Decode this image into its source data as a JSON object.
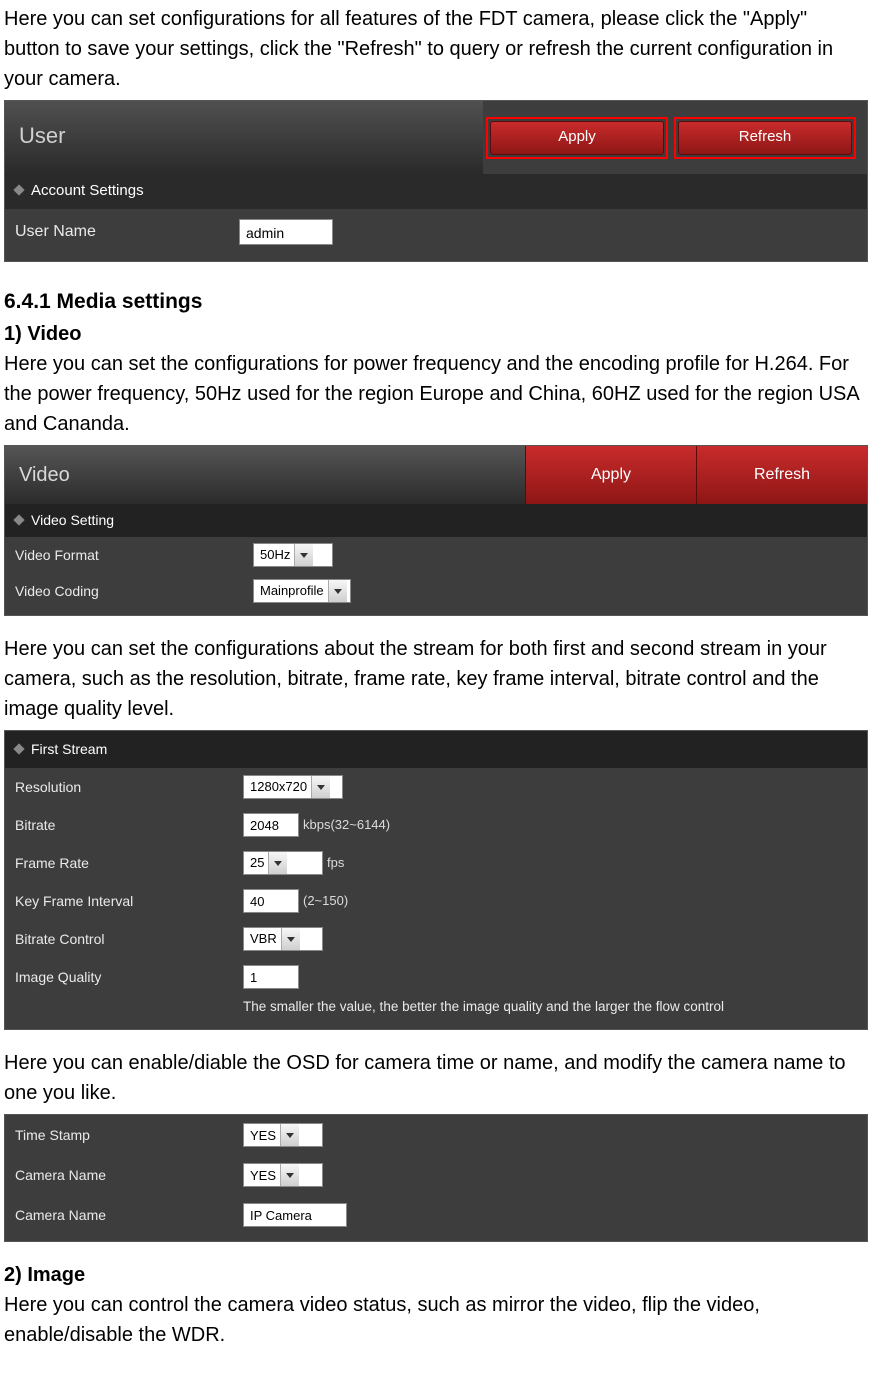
{
  "intro": "Here you can set configurations for all features of the FDT camera, please click the \"Apply\" button to save your settings, click the \"Refresh\" to query or refresh the current configuration in your camera.",
  "panel1": {
    "title": "User",
    "apply": "Apply",
    "refresh": "Refresh",
    "sub": "Account Settings",
    "username_label": "User Name",
    "username_value": "admin"
  },
  "section_641": "6.4.1 Media settings",
  "video_head": "1) Video",
  "video_intro": "Here you can set the configurations for power frequency and the encoding profile for H.264. For the power frequency, 50Hz used for the region Europe and China, 60HZ used for the region USA and Cananda.",
  "panel2": {
    "title": "Video",
    "apply": "Apply",
    "refresh": "Refresh",
    "sub": "Video Setting",
    "format_label": "Video Format",
    "format_value": "50Hz",
    "coding_label": "Video Coding",
    "coding_value": "Mainprofile"
  },
  "stream_intro": "Here you can set the configurations about the stream for both first and second stream in your camera, such as the resolution, bitrate, frame rate, key frame interval, bitrate control and the image quality level.",
  "panel3": {
    "sub": "First Stream",
    "resolution_label": "Resolution",
    "resolution_value": "1280x720",
    "bitrate_label": "Bitrate",
    "bitrate_value": "2048",
    "bitrate_hint": "kbps(32~6144)",
    "framerate_label": "Frame Rate",
    "framerate_value": "25",
    "framerate_hint": "fps",
    "keyframe_label": "Key Frame Interval",
    "keyframe_value": "40",
    "keyframe_hint": "(2~150)",
    "brcontrol_label": "Bitrate Control",
    "brcontrol_value": "VBR",
    "iq_label": "Image Quality",
    "iq_value": "1",
    "iq_note": "The smaller the value, the better the image quality and the larger the flow control"
  },
  "osd_intro": "Here you can enable/diable the OSD for camera time or name, and modify the camera name to one you like.",
  "panel4": {
    "timestamp_label": "Time Stamp",
    "timestamp_value": "YES",
    "camname_show_label": "Camera Name",
    "camname_show_value": "YES",
    "camname_label": "Camera Name",
    "camname_value": "IP Camera"
  },
  "image_head": "2) Image",
  "image_intro": "Here you can control the camera video status, such as mirror the video, flip the video, enable/disable the WDR."
}
